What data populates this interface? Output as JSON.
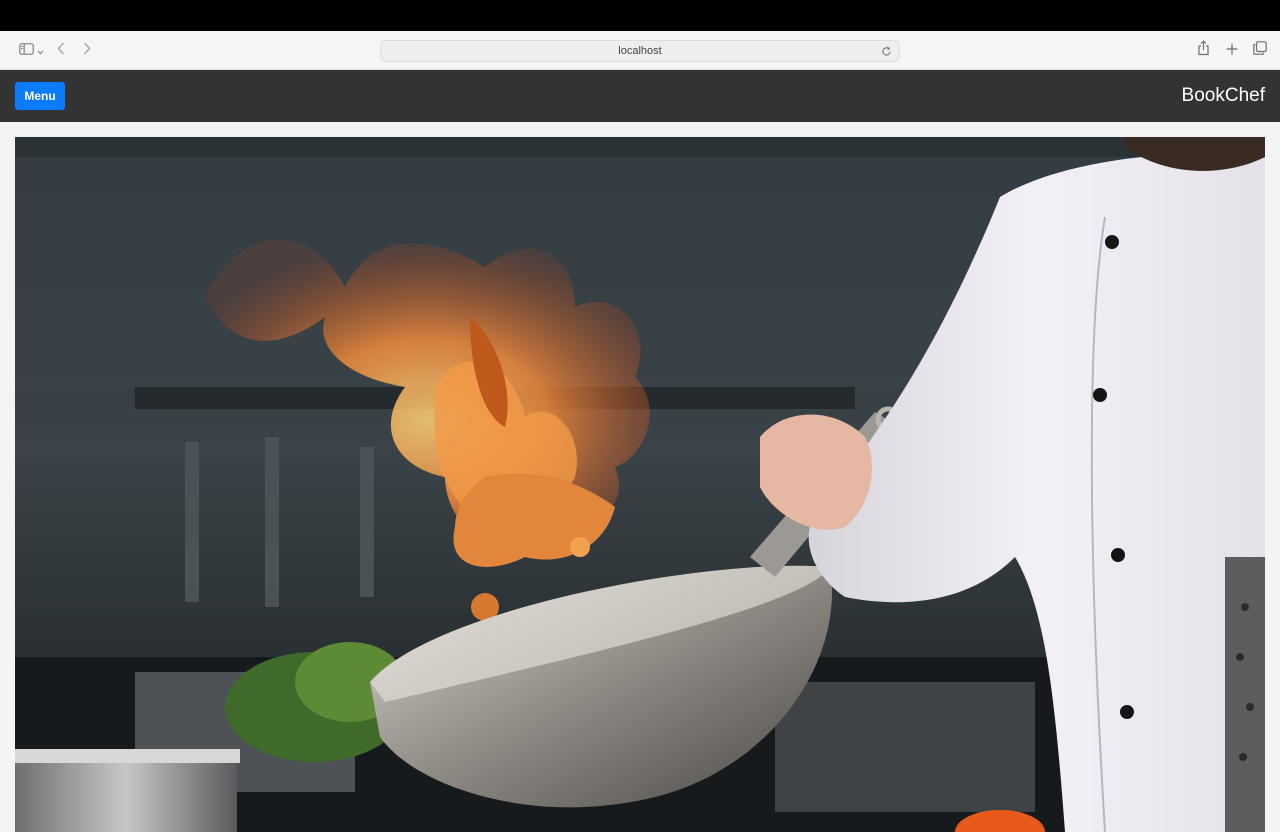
{
  "browser": {
    "url": "localhost",
    "icons": {
      "sidebar": "sidebar-icon",
      "back": "chevron-left-icon",
      "forward": "chevron-right-icon",
      "reload": "reload-icon",
      "share": "share-icon",
      "new_tab": "plus-icon",
      "tabs": "tabs-overview-icon"
    }
  },
  "header": {
    "menu_label": "Menu",
    "brand": "BookChef",
    "background": "#333333",
    "menu_color": "#0a7aff"
  },
  "hero": {
    "alt": "Chef tossing flaming food in a wok in a professional kitchen"
  }
}
